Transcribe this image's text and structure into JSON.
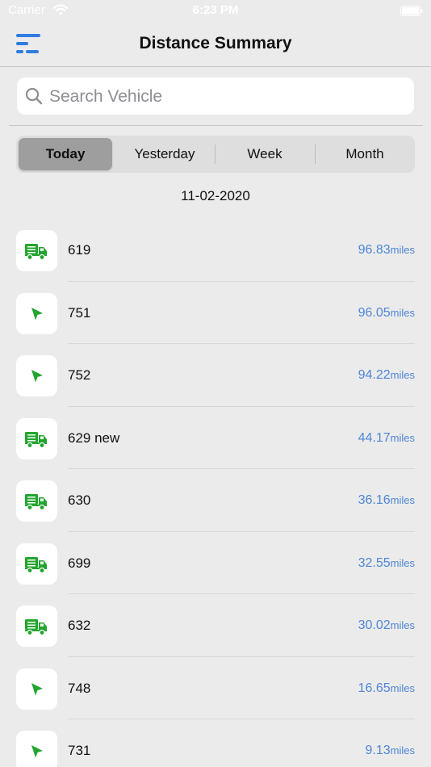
{
  "status_bar": {
    "carrier": "Carrier",
    "time": "6:23 PM"
  },
  "nav": {
    "title": "Distance Summary",
    "menu_icon": "menu-icon"
  },
  "search": {
    "placeholder": "Search Vehicle",
    "value": ""
  },
  "segments": [
    {
      "label": "Today",
      "selected": true
    },
    {
      "label": "Yesterday",
      "selected": false
    },
    {
      "label": "Week",
      "selected": false
    },
    {
      "label": "Month",
      "selected": false
    }
  ],
  "date": "11-02-2020",
  "colors": {
    "accent_green": "#22a52e",
    "distance_blue": "#4f86d6",
    "background": "#ebebeb"
  },
  "vehicles": [
    {
      "name": "619",
      "distance": "96.83",
      "unit": "miles",
      "icon": "truck-icon"
    },
    {
      "name": "751",
      "distance": "96.05",
      "unit": "miles",
      "icon": "navigation-arrow-icon"
    },
    {
      "name": "752",
      "distance": "94.22",
      "unit": "miles",
      "icon": "navigation-arrow-icon"
    },
    {
      "name": "629 new",
      "distance": "44.17",
      "unit": "miles",
      "icon": "truck-icon"
    },
    {
      "name": "630",
      "distance": "36.16",
      "unit": "miles",
      "icon": "truck-icon"
    },
    {
      "name": "699",
      "distance": "32.55",
      "unit": "miles",
      "icon": "truck-icon"
    },
    {
      "name": "632",
      "distance": "30.02",
      "unit": "miles",
      "icon": "truck-icon"
    },
    {
      "name": "748",
      "distance": "16.65",
      "unit": "miles",
      "icon": "navigation-arrow-icon"
    },
    {
      "name": "731",
      "distance": "9.13",
      "unit": "miles",
      "icon": "navigation-arrow-icon"
    }
  ]
}
